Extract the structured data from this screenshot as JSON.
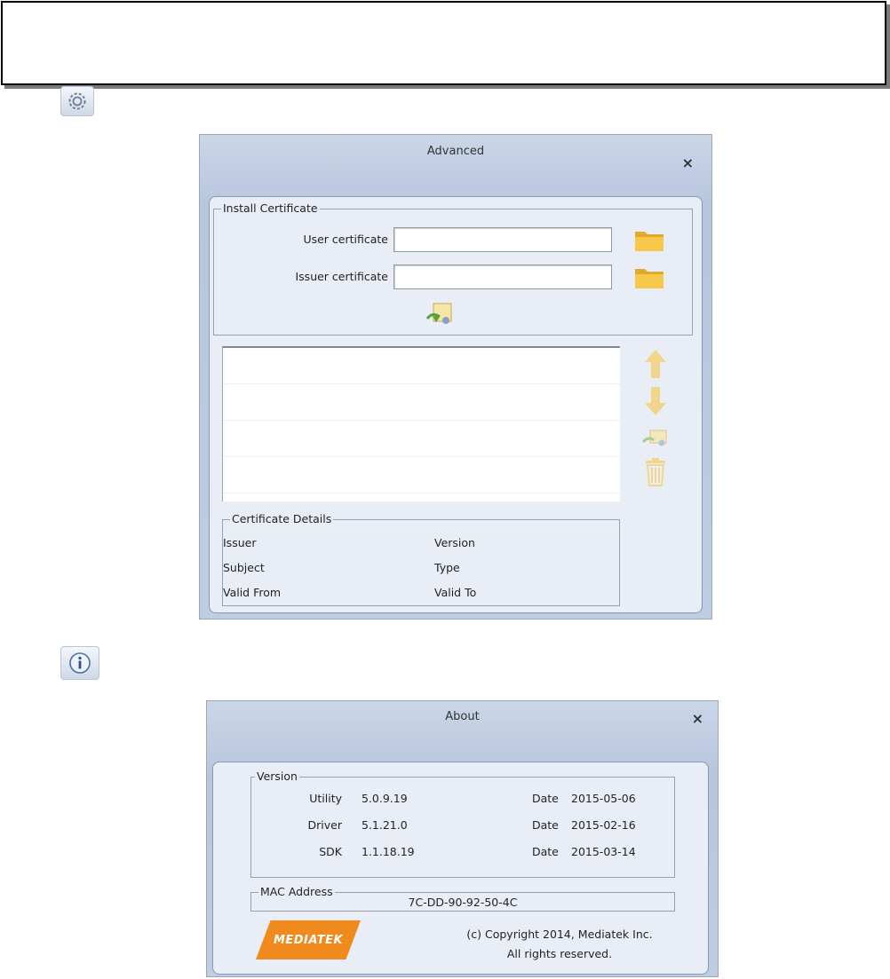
{
  "advanced": {
    "title": "Advanced",
    "close": "×",
    "install_certificate": {
      "legend": "Install Certificate",
      "user_certificate_label": "User certificate",
      "user_certificate_value": "",
      "issuer_certificate_label": "Issuer certificate",
      "issuer_certificate_value": ""
    },
    "certificate_list": {
      "rows": 5
    },
    "certificate_details": {
      "legend": "Certificate Details",
      "issuer": "Issuer",
      "version": "Version",
      "subject": "Subject",
      "type": "Type",
      "valid_from": "Valid From",
      "valid_to": "Valid To"
    }
  },
  "about": {
    "title": "About",
    "close": "×",
    "version": {
      "legend": "Version",
      "rows": [
        {
          "name": "Utility",
          "value": "5.0.9.19",
          "date_label": "Date",
          "date": "2015-05-06"
        },
        {
          "name": "Driver",
          "value": "5.1.21.0",
          "date_label": "Date",
          "date": "2015-02-16"
        },
        {
          "name": "SDK",
          "value": "1.1.18.19",
          "date_label": "Date",
          "date": "2015-03-14"
        }
      ]
    },
    "mac": {
      "legend": "MAC Address",
      "value": "7C-DD-90-92-50-4C"
    },
    "logo_text": "MEDIATEK",
    "copyright_line1": "(c) Copyright 2014, Mediatek Inc.",
    "copyright_line2": "All rights reserved."
  },
  "icons": {
    "settings": "gear-icon",
    "info": "info-icon",
    "folder": "folder-icon",
    "install": "install-certificate-icon",
    "up": "arrow-up-icon",
    "down": "arrow-down-icon",
    "delete": "trash-icon"
  },
  "colors": {
    "folder": "#f2c23a",
    "arrow": "#f3d98a",
    "logo": "#f08a1c",
    "window": "#bfcde2"
  }
}
